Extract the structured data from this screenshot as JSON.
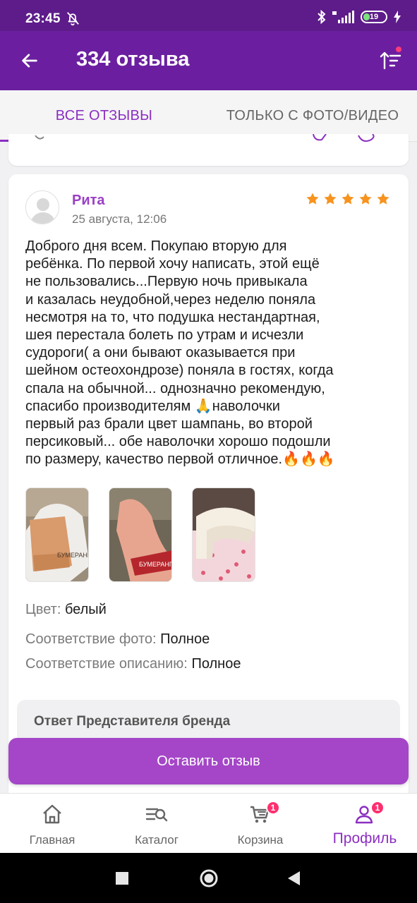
{
  "status_bar": {
    "time": "23:45",
    "battery": "19"
  },
  "app_bar": {
    "title": "334 отзыва"
  },
  "tabs": [
    {
      "label": "ВСЕ ОТЗЫВЫ",
      "active": true
    },
    {
      "label": "ТОЛЬКО С ФОТО/ВИДЕО",
      "active": false
    }
  ],
  "review": {
    "author": "Рита",
    "date": "25 августа, 12:06",
    "rating": 5,
    "text": "Доброго дня всем. Покупаю вторую для\nребёнка. По первой хочу написать, этой ещё\nне пользовались...Первую ночь привыкала\nи казалась неудобной,через  неделю поняла\nнесмотря на то, что подушка нестандартная,\nшея перестала болеть по утрам и  исчезли\nсудороги( а они бывают оказывается при\nшейном остеохондрозе) поняла в гостях, когда\nспала  на обычной... однозначно рекомендую,\nспасибо производителям 🙏наволочки\nпервый раз брали цвет шампань, во второй\nперсиковый... обе наволочки хорошо подошли\nпо размеру, качество первой отличное.🔥🔥🔥",
    "color_label": "Цвет:",
    "color_value": "белый",
    "photo_match_label": "Соответствие фото:",
    "photo_match_value": "Полное",
    "desc_match_label": "Соответствие описанию:",
    "desc_match_value": "Полное",
    "photo_captions": [
      "БУМЕРАНГ",
      "БУМЕРАНГ"
    ]
  },
  "brand_reply": {
    "title": "Ответ Представителя бренда"
  },
  "leave_review_label": "Оставить отзыв",
  "bottom_nav": {
    "items": [
      {
        "label": "Главная"
      },
      {
        "label": "Каталог"
      },
      {
        "label": "Корзина",
        "badge": "1"
      },
      {
        "label": "Профиль",
        "badge": "1",
        "active": true
      }
    ]
  },
  "colors": {
    "primary": "#6b1fa0",
    "accent": "#8c2fc1",
    "star": "#f7931e",
    "button": "#a446c7",
    "badge": "#ff2e6e"
  }
}
